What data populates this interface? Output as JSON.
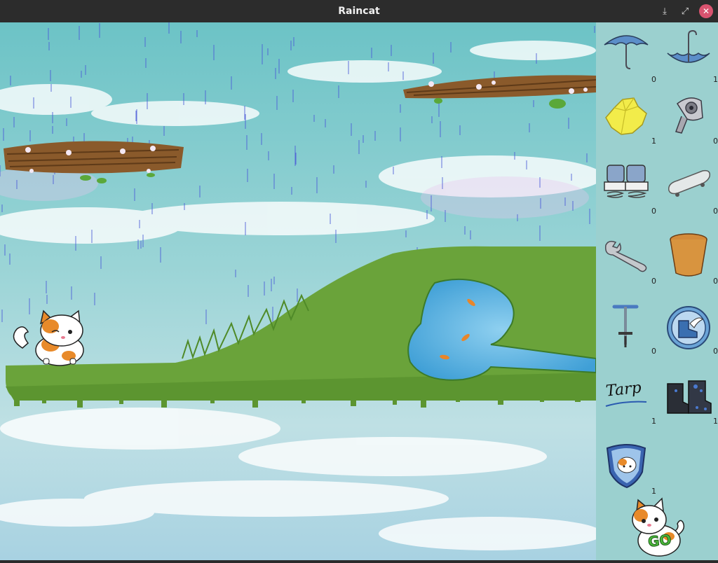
{
  "window": {
    "title": "Raincat",
    "minimize_icon": "download-icon",
    "maximize_icon": "maximize-icon",
    "close_icon": "close-icon",
    "minimize_glyph": "⤓",
    "maximize_glyph": "⤢",
    "close_glyph": "✕"
  },
  "toolbox": {
    "items": [
      {
        "name": "umbrella",
        "icon": "umbrella-icon",
        "count": "0"
      },
      {
        "name": "upside-down-umbrella",
        "icon": "upside-down-umbrella-icon",
        "count": "1"
      },
      {
        "name": "poncho",
        "icon": "poncho-icon",
        "count": "1"
      },
      {
        "name": "hair-dryer",
        "icon": "hair-dryer-icon",
        "count": "0"
      },
      {
        "name": "spring-boots",
        "icon": "spring-boots-icon",
        "count": "0"
      },
      {
        "name": "skateboard",
        "icon": "skateboard-icon",
        "count": "0"
      },
      {
        "name": "wrench",
        "icon": "wrench-icon",
        "count": "0"
      },
      {
        "name": "bucket",
        "icon": "bucket-icon",
        "count": "0"
      },
      {
        "name": "pogo-stick",
        "icon": "pogo-stick-icon",
        "count": "0"
      },
      {
        "name": "speed-boots-button",
        "icon": "winged-boot-icon",
        "count": "0"
      },
      {
        "name": "tarp",
        "icon": "tarp-icon",
        "count": "1",
        "label": "Tarp"
      },
      {
        "name": "rain-boots",
        "icon": "rain-boots-icon",
        "count": "1"
      },
      {
        "name": "shield",
        "icon": "cat-shield-icon",
        "count": "1"
      }
    ],
    "go_label": "GO"
  },
  "colors": {
    "sky": "#7cc9c8",
    "grass": "#6aa33a",
    "pond": "#5fb3e2",
    "sidebar": "#9bd0cf",
    "rain": "#4a5ad8"
  }
}
